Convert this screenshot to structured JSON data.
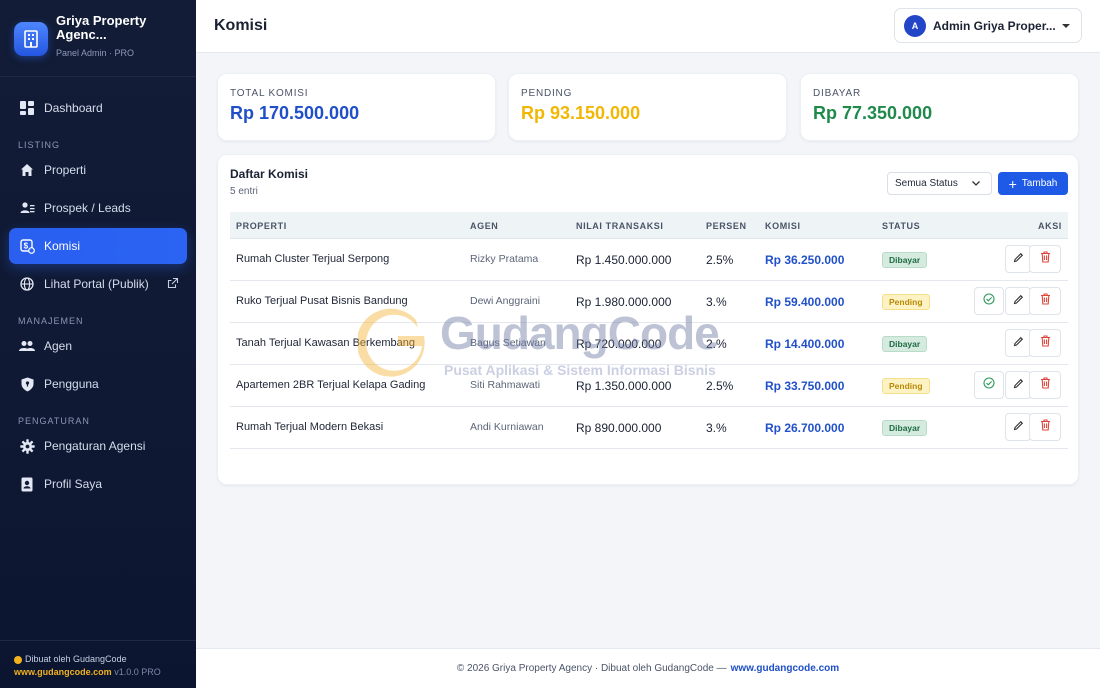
{
  "sidebar": {
    "brand_name": "Griya Property Agenc...",
    "brand_sub": "Panel Admin · PRO",
    "items": {
      "dashboard": "Dashboard",
      "properti": "Properti",
      "prospek": "Prospek / Leads",
      "komisi": "Komisi",
      "portal": "Lihat Portal (Publik)",
      "agen": "Agen",
      "pengguna": "Pengguna",
      "pengaturan_agensi": "Pengaturan Agensi",
      "profil": "Profil Saya"
    },
    "sections": {
      "listing": "LISTING",
      "manajemen": "MANAJEMEN",
      "pengaturan": "PENGATURAN"
    },
    "footer": {
      "made_by": "Dibuat oleh GudangCode",
      "site": "www.gudangcode.com",
      "version": "v1.0.0 PRO"
    }
  },
  "header": {
    "title": "Komisi",
    "user_initial": "A",
    "user_name": "Admin Griya Proper..."
  },
  "stats": {
    "total": {
      "label": "TOTAL KOMISI",
      "value": "Rp 170.500.000",
      "color": "#1f4fc9"
    },
    "pending": {
      "label": "PENDING",
      "value": "Rp 93.150.000",
      "color": "#f2b705"
    },
    "paid": {
      "label": "DIBAYAR",
      "value": "Rp 77.350.000",
      "color": "#1f8a4c"
    }
  },
  "table": {
    "title": "Daftar Komisi",
    "count": "5 entri",
    "filter_value": "Semua Status",
    "add_label": "Tambah",
    "columns": {
      "properti": "PROPERTI",
      "agen": "AGEN",
      "nilai": "NILAI TRANSAKSI",
      "persen": "PERSEN",
      "komisi": "KOMISI",
      "status": "STATUS",
      "aksi": "AKSI"
    },
    "rows": [
      {
        "properti": "Rumah Cluster Terjual Serpong",
        "agen": "Rizky Pratama",
        "nilai": "Rp 1.450.000.000",
        "persen": "2.5%",
        "komisi": "Rp 36.250.000",
        "status": "Dibayar"
      },
      {
        "properti": "Ruko Terjual Pusat Bisnis Bandung",
        "agen": "Dewi Anggraini",
        "nilai": "Rp 1.980.000.000",
        "persen": "3.%",
        "komisi": "Rp 59.400.000",
        "status": "Pending"
      },
      {
        "properti": "Tanah Terjual Kawasan Berkembang",
        "agen": "Bagus Setiawan",
        "nilai": "Rp 720.000.000",
        "persen": "2.%",
        "komisi": "Rp 14.400.000",
        "status": "Dibayar"
      },
      {
        "properti": "Apartemen 2BR Terjual Kelapa Gading",
        "agen": "Siti Rahmawati",
        "nilai": "Rp 1.350.000.000",
        "persen": "2.5%",
        "komisi": "Rp 33.750.000",
        "status": "Pending"
      },
      {
        "properti": "Rumah Terjual Modern Bekasi",
        "agen": "Andi Kurniawan",
        "nilai": "Rp 890.000.000",
        "persen": "3.%",
        "komisi": "Rp 26.700.000",
        "status": "Dibayar"
      }
    ]
  },
  "watermark": {
    "title": "GudangCode",
    "subtitle": "Pusat Aplikasi & Sistem Informasi Bisnis"
  },
  "footer": {
    "text": "© 2026 Griya Property Agency · Dibuat oleh GudangCode —",
    "link": "www.gudangcode.com"
  },
  "icons": [
    "building-icon",
    "dashboard-icon",
    "home-icon",
    "leads-icon",
    "commission-icon",
    "globe-icon",
    "external-link-icon",
    "agents-icon",
    "shield-icon",
    "gear-icon",
    "profile-icon",
    "pencil-icon",
    "trash-icon",
    "check-circle-icon",
    "plus-icon",
    "chevron-down-icon"
  ]
}
